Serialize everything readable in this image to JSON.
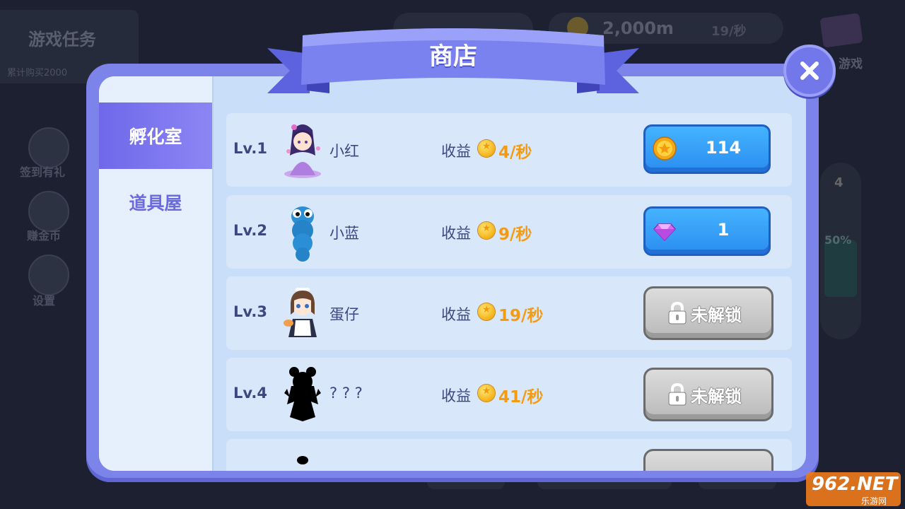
{
  "background": {
    "task_title": "游戏任务",
    "task_sub": "累计购买2000",
    "distance": "2,000m",
    "rate": "19/秒",
    "side_buttons": [
      "签到有礼",
      "赚金币",
      "设置"
    ],
    "game_label": "游戏",
    "meter_level": "4",
    "meter_percent": "50%"
  },
  "shop": {
    "title": "商店",
    "tabs": [
      {
        "label": "孵化室",
        "active": true
      },
      {
        "label": "道具屋",
        "active": false
      }
    ],
    "income_label": "收益",
    "items": [
      {
        "level": "Lv.1",
        "name": "小红",
        "income": "4/秒",
        "button_type": "coin",
        "button_text": "114"
      },
      {
        "level": "Lv.2",
        "name": "小蓝",
        "income": "9/秒",
        "button_type": "gem",
        "button_text": "1"
      },
      {
        "level": "Lv.3",
        "name": "蛋仔",
        "income": "19/秒",
        "button_type": "locked",
        "button_text": "未解锁"
      },
      {
        "level": "Lv.4",
        "name": "? ? ?",
        "income": "41/秒",
        "button_type": "locked",
        "button_text": "未解锁"
      }
    ]
  },
  "watermark": {
    "main": "962.NET",
    "sub": "乐游网"
  },
  "colors": {
    "accent": "#7c84ea",
    "coin": "#f39c12",
    "button_blue": "#2a8df0",
    "locked_gray": "#bcbcbc"
  }
}
